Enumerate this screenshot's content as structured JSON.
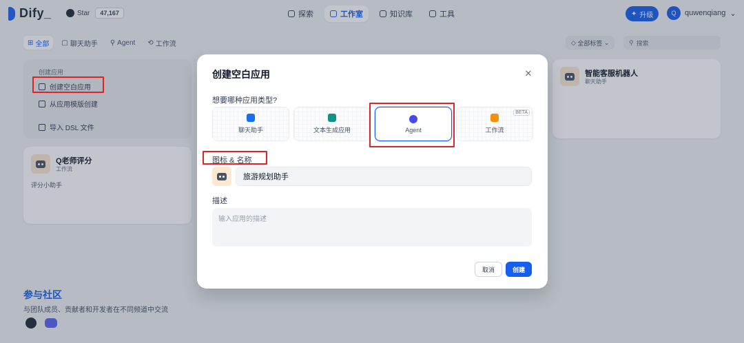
{
  "topbar": {
    "logo_text": "Dify_",
    "github_label": "Star",
    "github_count": "47,167",
    "nav": [
      "探索",
      "工作室",
      "知识库",
      "工具"
    ],
    "upgrade_label": "升级",
    "avatar_letter": "Q",
    "username": "quwenqiang"
  },
  "tabs": [
    "全部",
    "聊天助手",
    "Agent",
    "工作流"
  ],
  "filter_label": "全部标签",
  "search_placeholder": "搜索",
  "create_card": {
    "heading": "创建应用",
    "blank": "创建空白应用",
    "template": "从应用模版创建",
    "import": "导入 DSL 文件"
  },
  "apps": [
    {
      "name": "Q老师评分",
      "type": "工作流",
      "desc": "评分小助手"
    },
    {
      "name": "智能客服机器人",
      "type": "聊天助手"
    }
  ],
  "community": {
    "title": "参与社区",
    "desc": "与团队成员、贡献者和开发者在不同频道中交流"
  },
  "modal": {
    "title": "创建空白应用",
    "type_label": "想要哪种应用类型?",
    "types": [
      {
        "name": "聊天助手",
        "icon": "chat-icon",
        "color": "#1570ef"
      },
      {
        "name": "文本生成应用",
        "icon": "text-gen-icon",
        "color": "#0e9384"
      },
      {
        "name": "Agent",
        "icon": "robot-icon",
        "color": "#444ce7"
      },
      {
        "name": "工作流",
        "icon": "workflow-icon",
        "color": "#f79009",
        "badge": "BETA"
      }
    ],
    "name_label": "图标 & 名称",
    "name_value": "旅游规划助手",
    "desc_label": "描述",
    "desc_placeholder": "输入应用的描述",
    "cancel": "取消",
    "create": "创建"
  },
  "colors": {
    "accent": "#155eef",
    "annotation": "#e02424"
  }
}
